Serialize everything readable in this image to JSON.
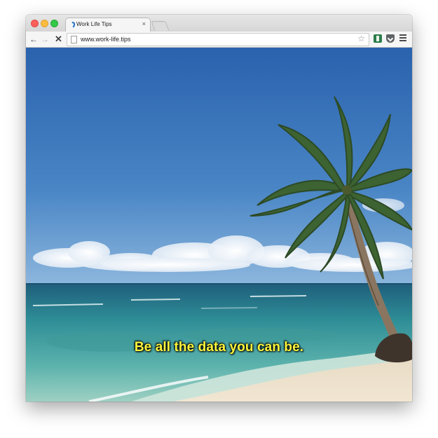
{
  "browser": {
    "tab": {
      "title": "Work Life Tips",
      "close_glyph": "×"
    },
    "toolbar": {
      "back_glyph": "←",
      "forward_glyph": "→",
      "stop_glyph": "✕",
      "url": "www.work-life.tips",
      "bookmark_glyph": "☆"
    },
    "icons": {
      "window_controls": [
        "close-icon",
        "minimize-icon",
        "maximize-icon"
      ],
      "extensions": [
        "evernote-extension-icon",
        "pocket-extension-icon",
        "menu-icon"
      ]
    }
  },
  "page": {
    "caption": "Be all the data you can be.",
    "caption_color": "#fbf63d",
    "scene": "beach-palm-tree-photo"
  }
}
